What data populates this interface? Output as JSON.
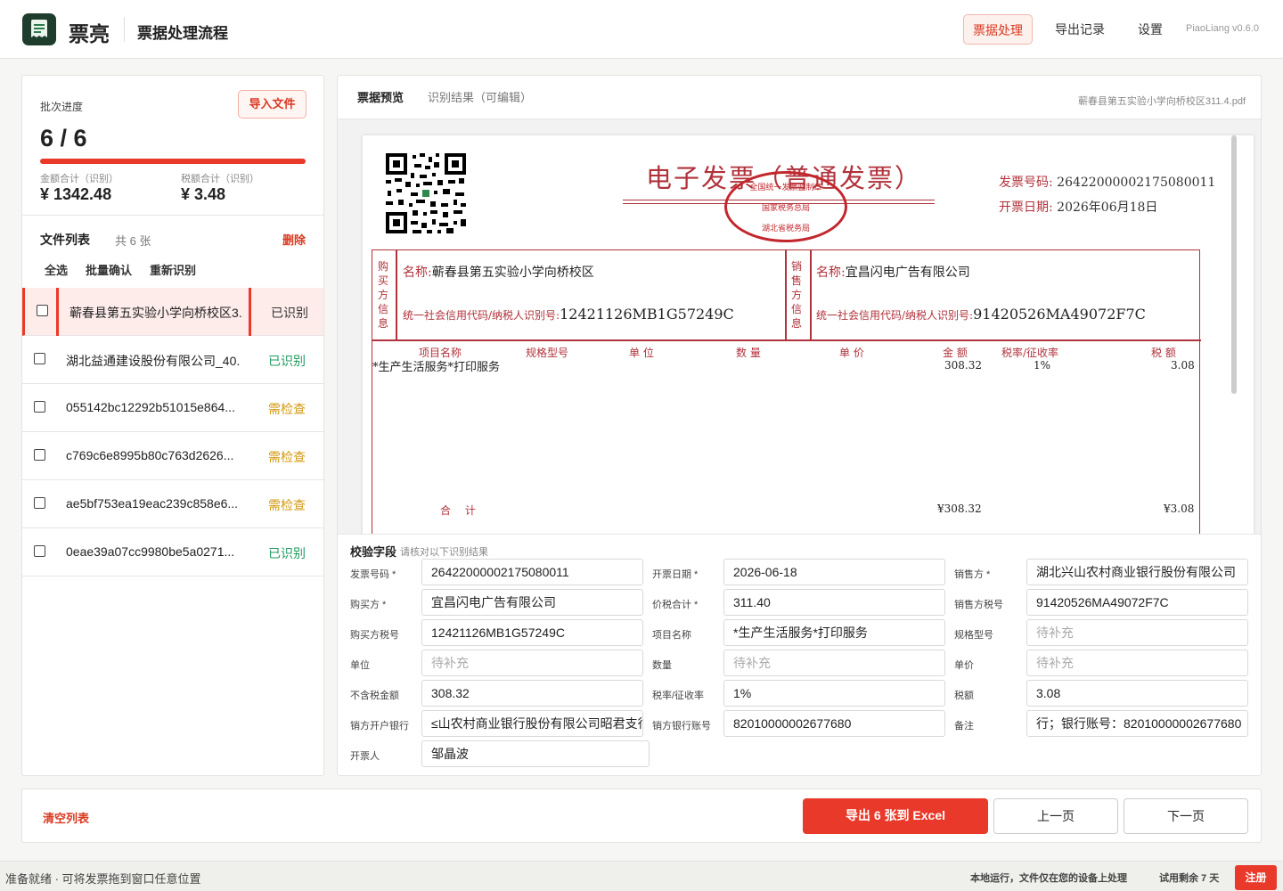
{
  "header": {
    "app_name": "票亮",
    "page_title": "票据处理流程",
    "nav": [
      "票据处理",
      "导出记录",
      "设置"
    ],
    "version": "PiaoLiang v0.6.0"
  },
  "batch": {
    "label": "批次进度",
    "import_label": "导入文件",
    "progress_text": "6 / 6",
    "progress": 1.0,
    "amount_label": "金额合计（识别）",
    "amount": "¥ 1342.48",
    "tax_label": "税额合计（识别）",
    "tax": "¥ 3.48"
  },
  "filelist": {
    "title": "文件列表",
    "count": "共 6 张",
    "delete_label": "删除",
    "actions": [
      "全选",
      "批量确认",
      "重新识别"
    ],
    "rows": [
      {
        "name": "蕲春县第五实验小学向桥校区3...",
        "status": "已识别",
        "status_color": "#333333"
      },
      {
        "name": "湖北益通建设股份有限公司_40....",
        "status": "已识别",
        "status_color": "#1e9a5c"
      },
      {
        "name": "055142bc12292b51015e864...",
        "status": "需检查",
        "status_color": "#d39a12"
      },
      {
        "name": "c769c6e8995b80c763d2626...",
        "status": "需检查",
        "status_color": "#d39a12"
      },
      {
        "name": "ae5bf753ea19eac239c858e6...",
        "status": "需检查",
        "status_color": "#d39a12"
      },
      {
        "name": "0eae39a07cc9980be5a0271...",
        "status": "已识别",
        "status_color": "#1e9a5c"
      }
    ]
  },
  "tabs": {
    "preview": "票据预览",
    "result": "识别结果（可编辑）",
    "file": "蕲春县第五实验小学向桥校区311.4.pdf"
  },
  "invoice": {
    "title": "电子发票（普通发票）",
    "stamp_top": "全国统一发票监制章",
    "stamp_mid": "国家税务总局",
    "stamp_bottom": "湖北省税务局",
    "no_label": "发票号码:",
    "no": "26422000002175080011",
    "date_label": "开票日期:",
    "date": "2026年06月18日",
    "buyer_tag": "购买方信息",
    "seller_tag": "销售方信息",
    "buyer_name_label": "名称:",
    "buyer_name": "蕲春县第五实验小学向桥校区",
    "buyer_tax_label": "统一社会信用代码/纳税人识别号:",
    "buyer_tax": "12421126MB1G57249C",
    "seller_name_label": "名称:",
    "seller_name": "宜昌闪电广告有限公司",
    "seller_tax_label": "统一社会信用代码/纳税人识别号:",
    "seller_tax": "91420526MA49072F7C",
    "cols": [
      "项目名称",
      "规格型号",
      "单 位",
      "数 量",
      "单 价",
      "金 额",
      "税率/征收率",
      "税 额"
    ],
    "item": "*生产生活服务*打印服务",
    "item_amount": "308.32",
    "item_rate": "1%",
    "item_tax": "3.08",
    "total_label": "合 计",
    "total_amount": "¥308.32",
    "total_tax": "¥3.08"
  },
  "fields": {
    "title": "校验字段",
    "hint": "请核对以下识别结果",
    "items": [
      {
        "label": "发票号码 *",
        "value": "26422000002175080011"
      },
      {
        "label": "开票日期 *",
        "value": "2026-06-18"
      },
      {
        "label": "销售方 *",
        "value": "湖北兴山农村商业银行股份有限公司"
      },
      {
        "label": "购买方 *",
        "value": "宜昌闪电广告有限公司"
      },
      {
        "label": "价税合计 *",
        "value": "311.40"
      },
      {
        "label": "销售方税号",
        "value": "91420526MA49072F7C"
      },
      {
        "label": "购买方税号",
        "value": "12421126MB1G57249C"
      },
      {
        "label": "项目名称",
        "value": "*生产生活服务*打印服务"
      },
      {
        "label": "规格型号",
        "value": "",
        "placeholder": "待补充"
      },
      {
        "label": "单位",
        "value": "",
        "placeholder": "待补充"
      },
      {
        "label": "数量",
        "value": "",
        "placeholder": "待补充"
      },
      {
        "label": "单价",
        "value": "",
        "placeholder": "待补充"
      },
      {
        "label": "不含税金额",
        "value": "308.32"
      },
      {
        "label": "税率/征收率",
        "value": "1%"
      },
      {
        "label": "税额",
        "value": "3.08"
      },
      {
        "label": "销方开户银行",
        "value": "≤山农村商业银行股份有限公司昭君支行"
      },
      {
        "label": "销方银行账号",
        "value": "82010000002677680"
      },
      {
        "label": "备注",
        "value": "行；银行账号：82010000002677680"
      },
      {
        "label": "开票人",
        "value": "邹晶波"
      }
    ]
  },
  "footer": {
    "clear": "清空列表",
    "export": "导出 6 张到 Excel",
    "prev": "上一页",
    "next": "下一页"
  },
  "statusbar": {
    "left": "准备就绪 · 可将发票拖到窗口任意位置",
    "local": "本地运行，文件仅在您的设备上处理",
    "trial": "试用剩余 7 天",
    "register": "注册"
  }
}
